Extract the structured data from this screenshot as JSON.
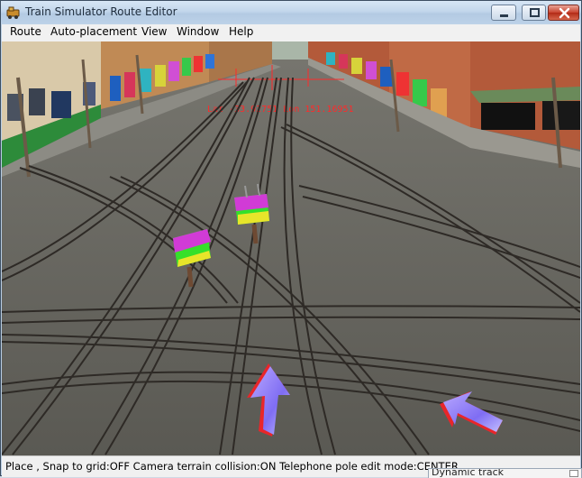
{
  "window": {
    "title": "Train Simulator Route Editor",
    "icon": "train-app-icon",
    "controls": {
      "minimize": "minimize-icon",
      "maximize": "maximize-icon",
      "close": "close-icon"
    }
  },
  "menu": {
    "items": [
      {
        "label": "Route"
      },
      {
        "label": "Auto-placement"
      },
      {
        "label": "View"
      },
      {
        "label": "Window"
      },
      {
        "label": "Help"
      }
    ]
  },
  "viewport": {
    "coordinates": "Lat -33.92751 Lon 151.16951",
    "markers": [
      {
        "type": "placement-marker",
        "color": "#e7e52a"
      },
      {
        "type": "placement-marker",
        "color": "#e7e52a"
      }
    ],
    "arrows": [
      {
        "name": "move-forward-arrow",
        "color": "#7e6cf0"
      },
      {
        "name": "move-diagonal-arrow",
        "color": "#7e6cf0"
      }
    ]
  },
  "status": {
    "text": "Place , Snap to grid:OFF Camera terrain collision:ON Telephone pole edit mode:CENTER"
  },
  "panels": {
    "dynamic_track": {
      "title": "Dynamic track"
    }
  },
  "colors": {
    "titlebar": "#c2d6eb",
    "close_button": "#c8432f",
    "road": "#5e5d57",
    "rail": "#2e2a26",
    "marker_green": "#35e02a",
    "marker_magenta": "#d13bd6",
    "arrow_red": "#e8262a",
    "arrow_blue": "#8c7cf7"
  }
}
